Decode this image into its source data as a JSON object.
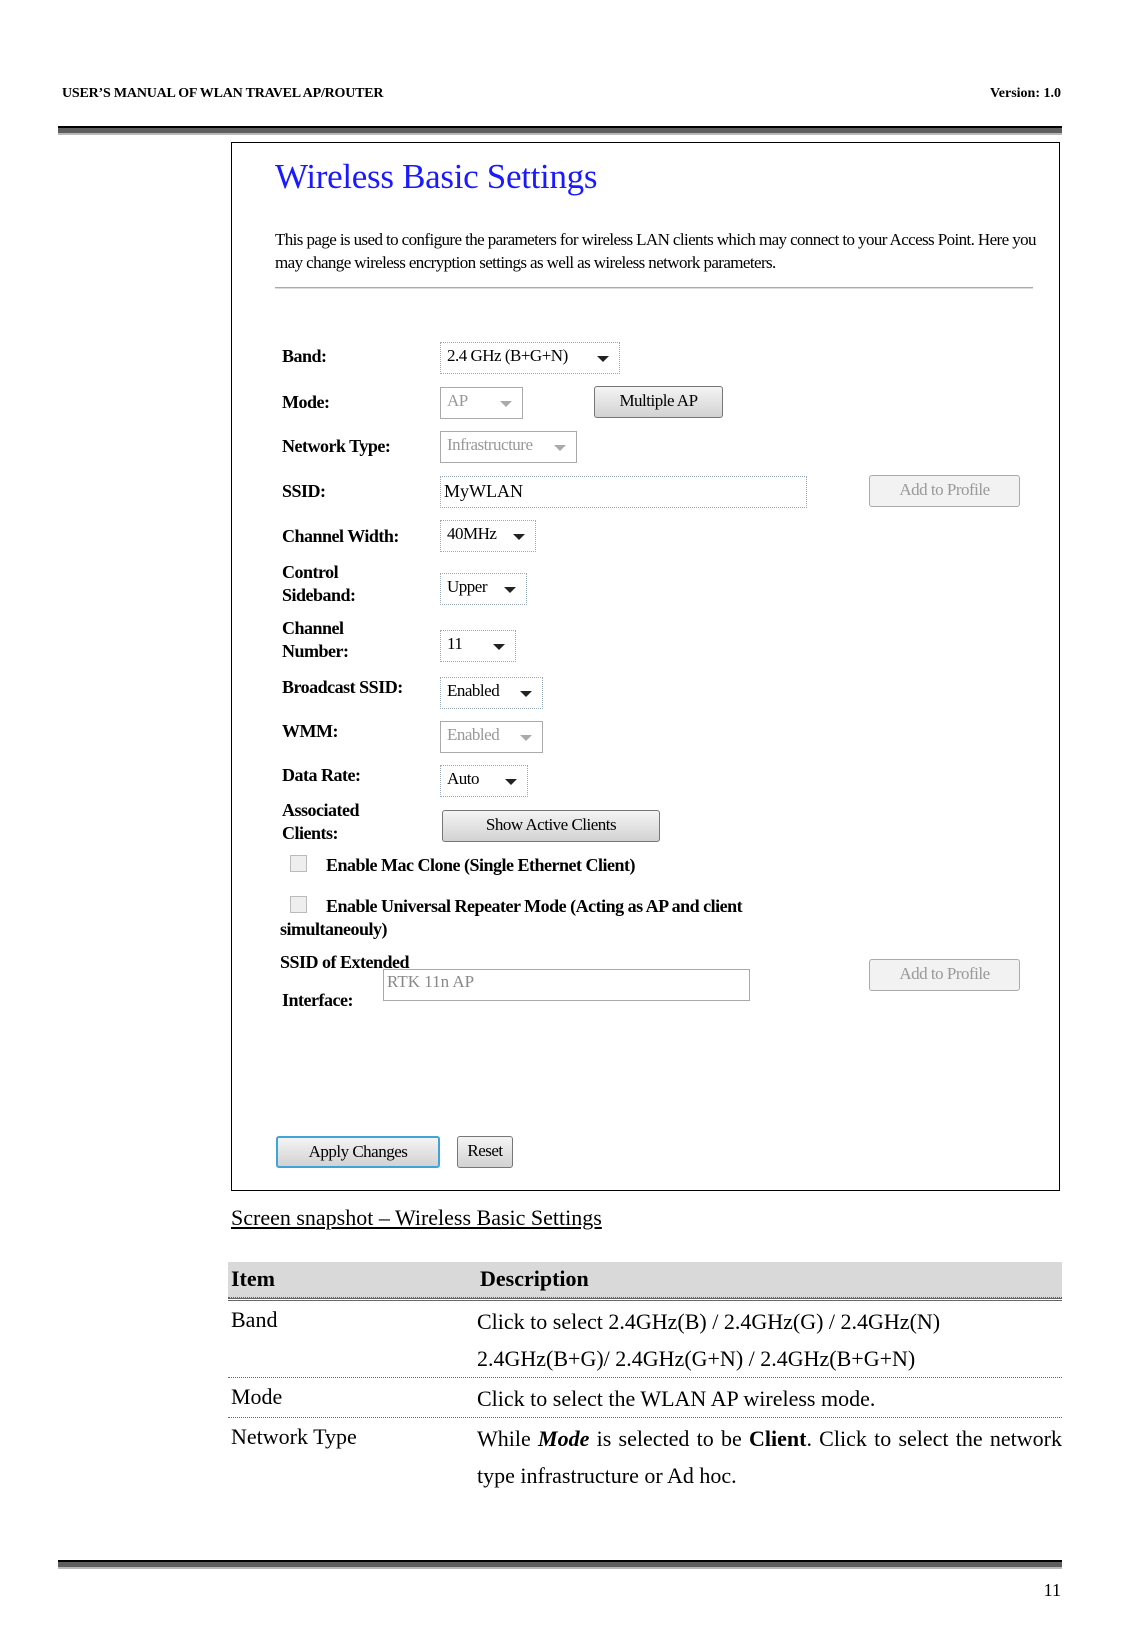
{
  "header": {
    "manual_title": "USER’S MANUAL OF WLAN TRAVEL AP/ROUTER",
    "version": "Version: 1.0"
  },
  "screenshot": {
    "title": "Wireless Basic Settings",
    "description": "This page is used to configure the parameters for wireless LAN clients which may connect to your Access Point. Here you may change wireless encryption settings as well as wireless network parameters.",
    "fields": {
      "band": {
        "label": "Band:",
        "value": "2.4 GHz (B+G+N)"
      },
      "mode": {
        "label": "Mode:",
        "value": "AP"
      },
      "multiple_ap_button": "Multiple AP",
      "network_type": {
        "label": "Network Type:",
        "value": "Infrastructure"
      },
      "ssid": {
        "label": "SSID:",
        "value": "MyWLAN"
      },
      "add_to_profile_button": "Add to Profile",
      "channel_width": {
        "label": "Channel Width:",
        "value": "40MHz"
      },
      "control_sideband": {
        "label_line1": "Control",
        "label_line2": "Sideband:",
        "value": "Upper"
      },
      "channel_number": {
        "label_line1": "Channel",
        "label_line2": "Number:",
        "value": "11"
      },
      "broadcast_ssid": {
        "label": "Broadcast SSID:",
        "value": "Enabled"
      },
      "wmm": {
        "label": "WMM:",
        "value": "Enabled"
      },
      "data_rate": {
        "label": "Data Rate:",
        "value": "Auto"
      },
      "associated_clients": {
        "label_line1": "Associated",
        "label_line2": "Clients:",
        "button": "Show Active Clients"
      },
      "mac_clone": {
        "label": "Enable Mac Clone (Single Ethernet Client)",
        "checked": false
      },
      "universal_repeater": {
        "label_line1": "Enable Universal Repeater Mode (Acting as AP and client",
        "label_line2": "simultaneouly)",
        "checked": false
      },
      "extended_ssid": {
        "label_line1": "SSID of Extended",
        "label_line2": "Interface:",
        "value": "RTK 11n AP",
        "button": "Add to Profile"
      }
    },
    "apply_button": "Apply Changes",
    "reset_button": "Reset"
  },
  "caption": "Screen snapshot – Wireless Basic Settings",
  "table": {
    "headers": [
      "Item",
      "Description"
    ],
    "rows": [
      {
        "item": "Band",
        "desc_line1": "Click to select 2.4GHz(B) / 2.4GHz(G) / 2.4GHz(N)",
        "desc_line2": "2.4GHz(B+G)/ 2.4GHz(G+N) / 2.4GHz(B+G+N)"
      },
      {
        "item": "Mode",
        "desc": "Click to select the WLAN AP wireless mode."
      },
      {
        "item": "Network Type",
        "desc_pre": "While ",
        "desc_mode": "Mode",
        "desc_mid": " is selected to be ",
        "desc_client": "Client",
        "desc_post": ". Click to select the network type infrastructure or Ad hoc."
      }
    ]
  },
  "page_number": "11"
}
